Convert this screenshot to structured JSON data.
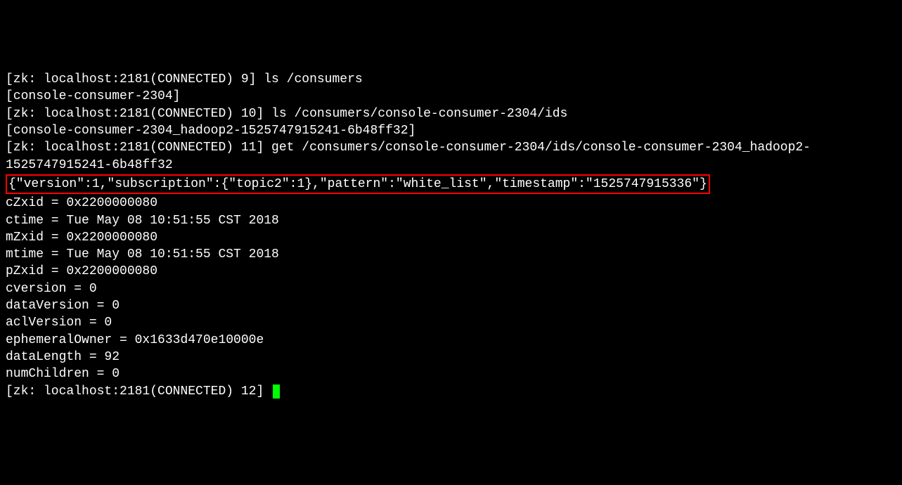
{
  "lines": {
    "l1": "[zk: localhost:2181(CONNECTED) 9] ls /consumers",
    "l2": "[console-consumer-2304]",
    "l3": "[zk: localhost:2181(CONNECTED) 10] ls /consumers/console-consumer-2304/ids",
    "l4": "[console-consumer-2304_hadoop2-1525747915241-6b48ff32]",
    "l5": "[zk: localhost:2181(CONNECTED) 11] get /consumers/console-consumer-2304/ids/console-consumer-2304_hadoop2-1525747915241-6b48ff32",
    "l6": "{\"version\":1,\"subscription\":{\"topic2\":1},\"pattern\":\"white_list\",\"timestamp\":\"1525747915336\"}",
    "l7": "cZxid = 0x2200000080",
    "l8": "ctime = Tue May 08 10:51:55 CST 2018",
    "l9": "mZxid = 0x2200000080",
    "l10": "mtime = Tue May 08 10:51:55 CST 2018",
    "l11": "pZxid = 0x2200000080",
    "l12": "cversion = 0",
    "l13": "dataVersion = 0",
    "l14": "aclVersion = 0",
    "l15": "ephemeralOwner = 0x1633d470e10000e",
    "l16": "dataLength = 92",
    "l17": "numChildren = 0",
    "l18": "[zk: localhost:2181(CONNECTED) 12] "
  }
}
